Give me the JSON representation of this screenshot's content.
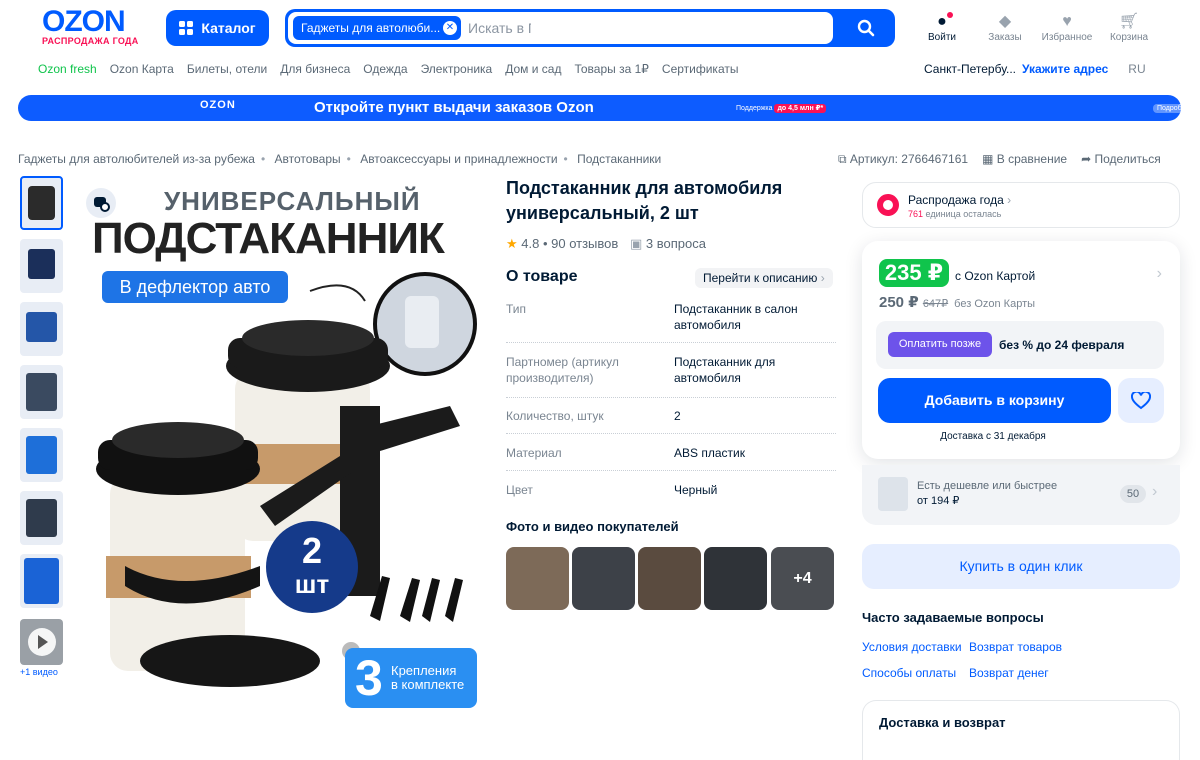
{
  "header": {
    "logo": "OZON",
    "logo_sub": "РАСПРОДАЖА ГОДА",
    "catalog_label": "Каталог",
    "search_chip": "Гаджеты для автолюби...",
    "search_placeholder": "Искать в Гаджеты для автолюбителей из-за рубежа",
    "icons": {
      "login": "Войти",
      "orders": "Заказы",
      "favorites": "Избранное",
      "cart": "Корзина"
    }
  },
  "nav": {
    "items": [
      "Ozon fresh",
      "Ozon Карта",
      "Билеты, отели",
      "Для бизнеса",
      "Одежда",
      "Электроника",
      "Дом и сад",
      "Товары за 1₽",
      "Сертификаты"
    ],
    "city": "Санкт-Петербу...",
    "address": "Укажите адрес",
    "lang": "RU"
  },
  "banner": {
    "logo": "OZON",
    "text": "Откройте пункт выдачи заказов Ozon",
    "support_prefix": "Поддержка",
    "support_amount": "до 4,5 млн ₽*",
    "more": "Подробнее"
  },
  "breadcrumbs": [
    "Гаджеты для автолюбителей из-за рубежа",
    "Автотовары",
    "Автоаксессуары и принадлежности",
    "Подстаканники"
  ],
  "actions": {
    "article": "Артикул: 2766467161",
    "compare": "В сравнение",
    "share": "Поделиться"
  },
  "gallery": {
    "video_label": "+1 видео"
  },
  "hero": {
    "line1": "УНИВЕРСАЛЬНЫЙ",
    "line2": "ПОДСТАКАННИК",
    "pill": "В дефлектор авто",
    "count": "2",
    "unit": "шт",
    "mount_num": "3",
    "mount_text1": "Крепления",
    "mount_text2": "в комплекте"
  },
  "product": {
    "title": "Подстаканник для автомобиля универсальный, 2 шт",
    "rating": "4.8 • 90 отзывов",
    "questions": "3 вопроса",
    "about": "О товаре",
    "goto_desc": "Перейти к описанию",
    "specs": [
      {
        "k": "Тип",
        "v": "Подстаканник в салон автомобиля"
      },
      {
        "k": "Партномер (артикул производителя)",
        "v": "Подстаканник для автомобиля"
      },
      {
        "k": "Количество, штук",
        "v": "2"
      },
      {
        "k": "Материал",
        "v": "ABS пластик"
      },
      {
        "k": "Цвет",
        "v": "Черный"
      }
    ],
    "photos_title": "Фото и видео покупателей",
    "more_photos": "+4"
  },
  "sale": {
    "title": "Распродажа года",
    "count": "761",
    "count_suffix": "единица осталась"
  },
  "price": {
    "card_price": "235 ₽",
    "card_label": "с Ozon Картой",
    "regular": "250 ₽",
    "old": "647₽",
    "no_card": "без Ozon Карты",
    "pay_later": "Оплатить позже",
    "pay_later_text": "без % до 24 февраля",
    "add_to_cart": "Добавить в корзину",
    "delivery": "Доставка с 31 декабря"
  },
  "cheaper": {
    "text": "Есть дешевле или быстрее",
    "from": "от 194 ₽",
    "count": "50"
  },
  "one_click": "Купить в один клик",
  "faq": {
    "title": "Часто задаваемые вопросы",
    "links": [
      "Условия доставки",
      "Возврат товаров",
      "Способы оплаты",
      "Возврат денег"
    ]
  },
  "delivery_section": "Доставка и возврат",
  "colors": {
    "brand": "#005bff",
    "sale": "#f91155",
    "green": "#10c44c",
    "paylater": "#6d53ea"
  }
}
